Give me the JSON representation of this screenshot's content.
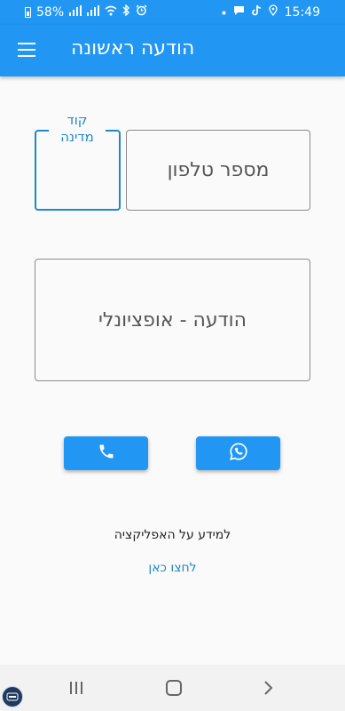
{
  "status_bar": {
    "battery": "58%",
    "time": "15:49",
    "icons": [
      "battery-icon",
      "signal-icon",
      "signal-icon-2",
      "wifi-icon",
      "bluetooth-icon",
      "alarm-icon",
      "dot-icon",
      "message-icon",
      "tiktok-icon",
      "location-icon"
    ]
  },
  "app_bar": {
    "title": "הודעה ראשונה",
    "menu_icon": "hamburger-menu-icon"
  },
  "form": {
    "country_code_label": "קוד מדינה",
    "phone_placeholder": "מספר טלפון",
    "message_placeholder": "הודעה - אופציונלי"
  },
  "buttons": {
    "call_icon": "phone-icon",
    "whatsapp_icon": "whatsapp-icon"
  },
  "info": {
    "text": "למידע על האפליקציה",
    "link": "לחצו כאן"
  },
  "nav_bar": {
    "icons": [
      "recents-icon",
      "home-icon",
      "back-icon"
    ]
  },
  "colors": {
    "primary": "#2196f3",
    "accent_text": "#1e88c8",
    "background": "#fafafa"
  }
}
